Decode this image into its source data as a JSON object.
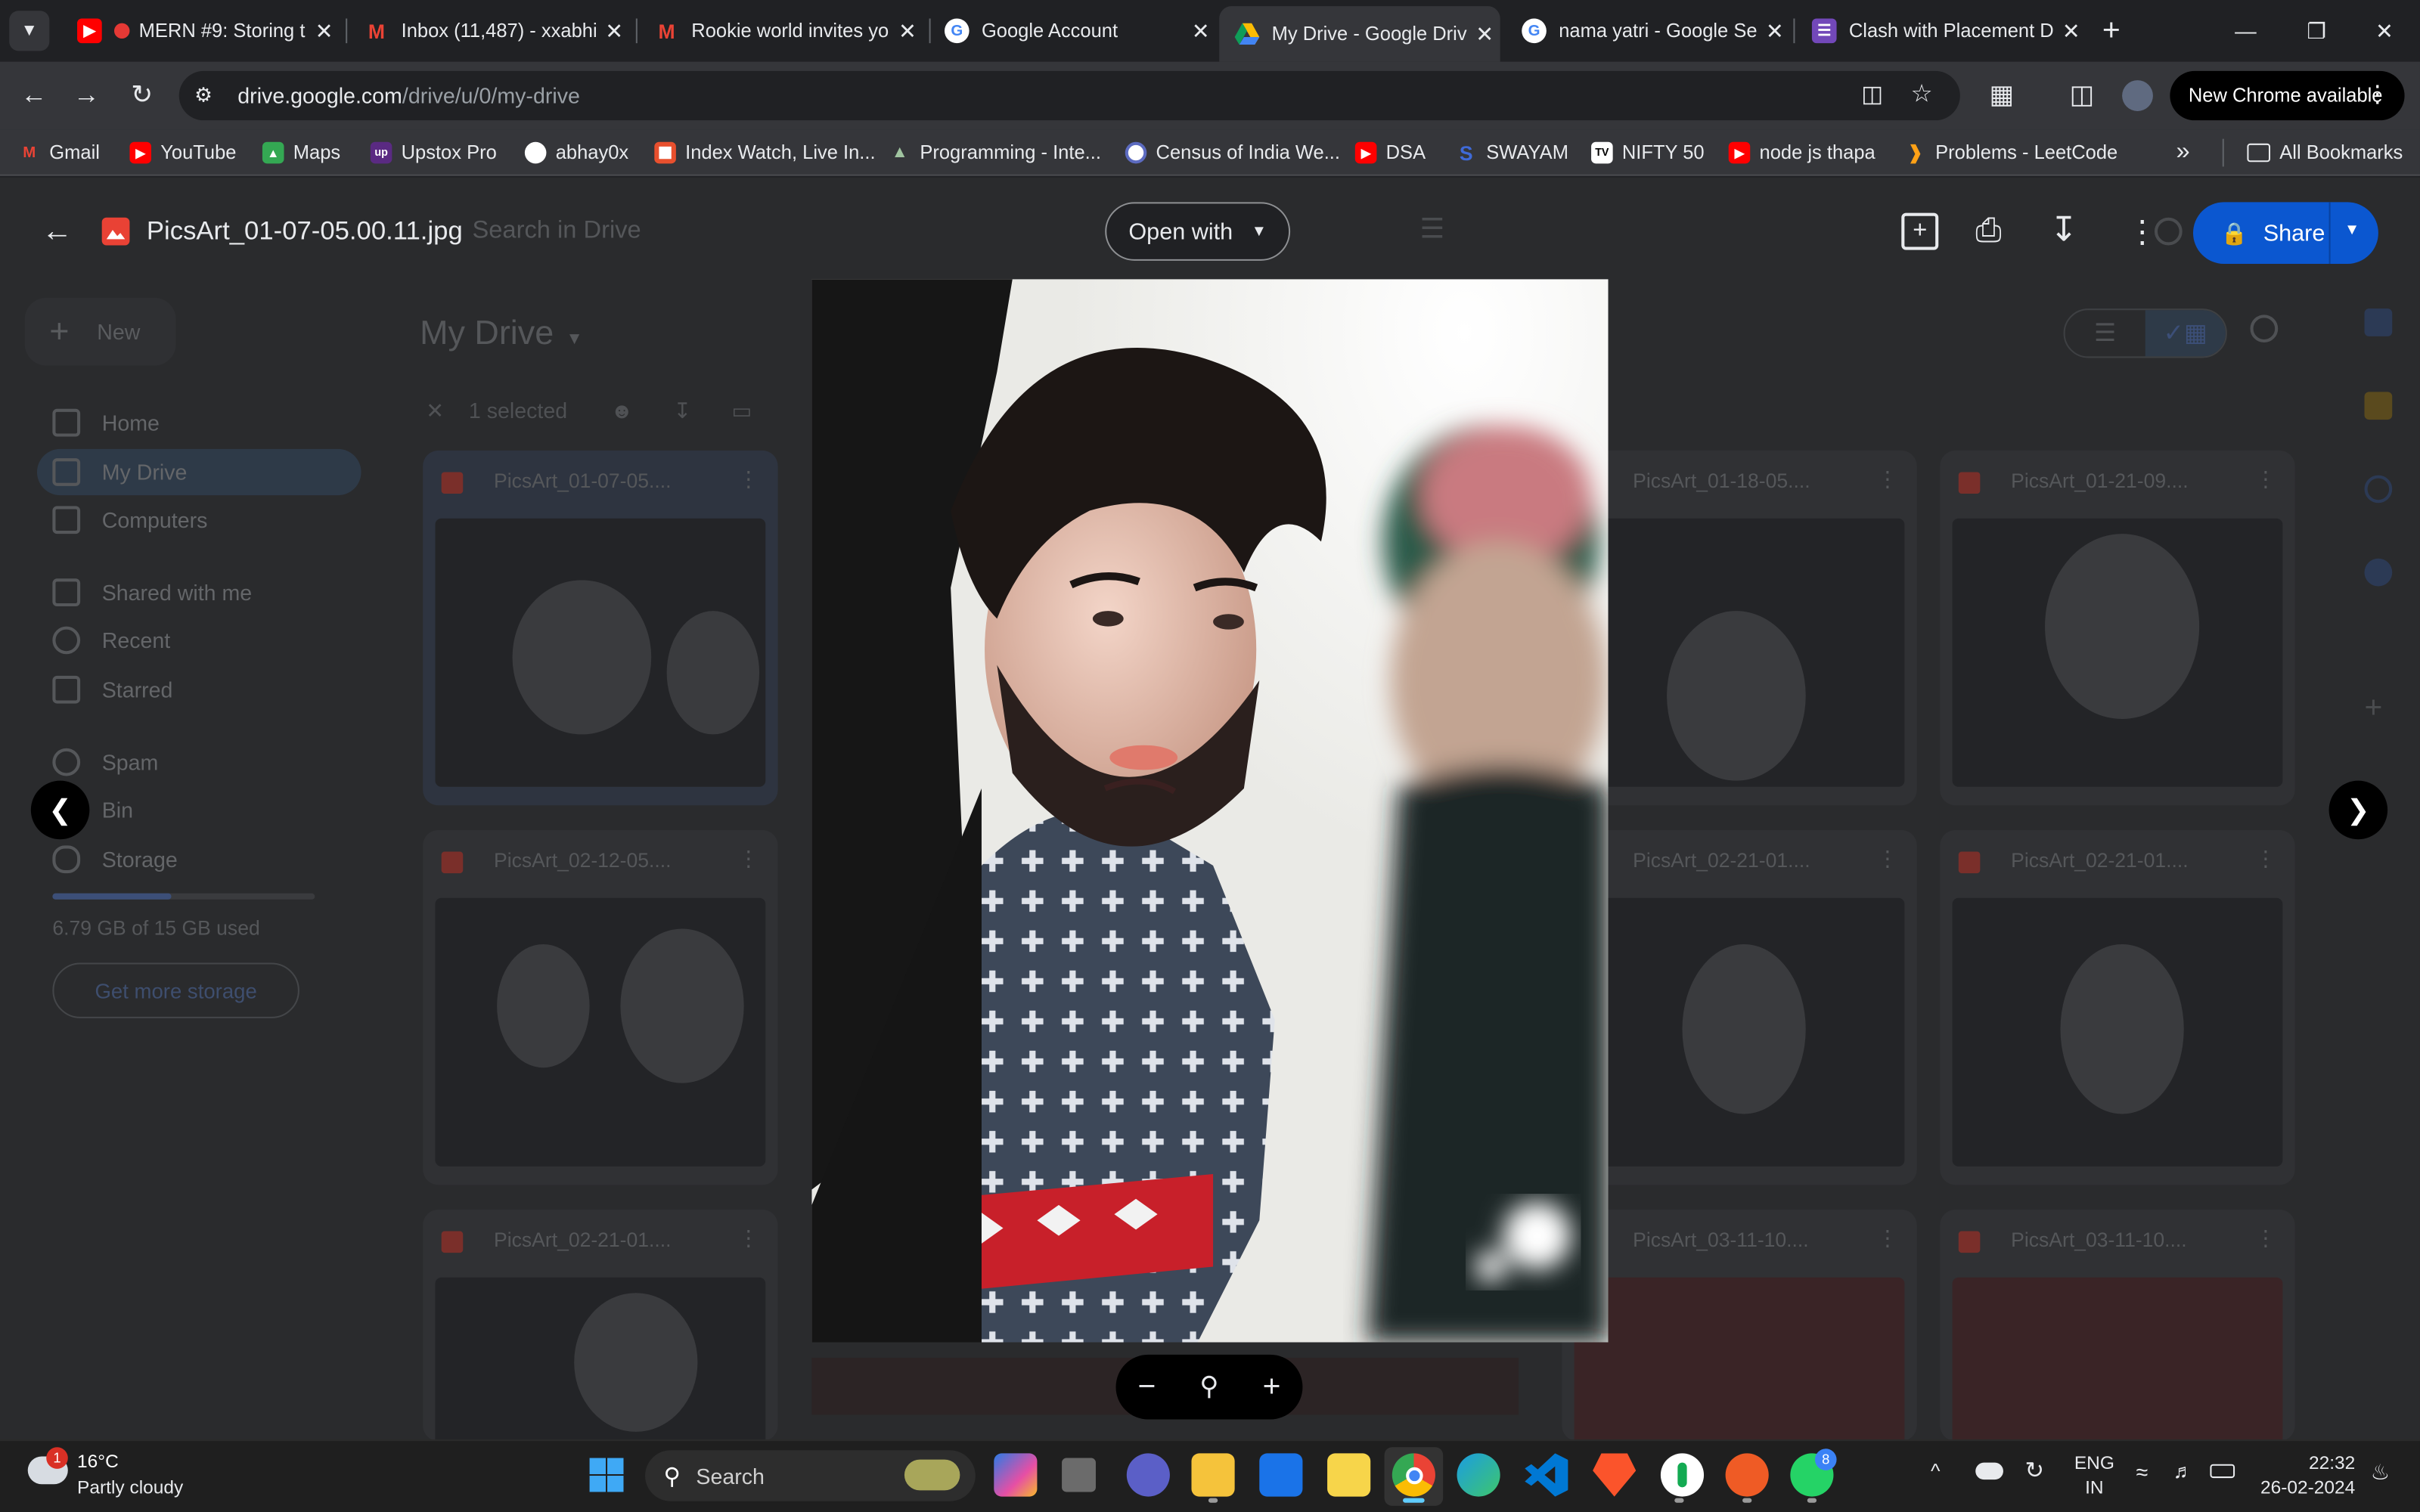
{
  "browser": {
    "tabs": [
      {
        "title": "MERN #9: Storing t",
        "icon": "youtube-icon",
        "color": "#ff0000"
      },
      {
        "title": "Inbox (11,487) - xxabhi",
        "icon": "gmail-icon",
        "color": "#ea4335"
      },
      {
        "title": "Rookie world invites yo",
        "icon": "gmail-icon",
        "color": "#ea4335"
      },
      {
        "title": "Google Account",
        "icon": "google-icon",
        "color": "#4285f4"
      },
      {
        "title": "My Drive - Google Driv",
        "icon": "drive-icon",
        "color": "#fbbc04"
      },
      {
        "title": "nama yatri - Google Se",
        "icon": "google-icon",
        "color": "#4285f4"
      },
      {
        "title": "Clash with Placement D",
        "icon": "forms-icon",
        "color": "#7248b9"
      }
    ],
    "url_host": "drive.google.com",
    "url_path": "/drive/u/0/my-drive",
    "update_label": "New Chrome available",
    "bookmarks": [
      {
        "label": "Gmail",
        "icon": "gmail-icon",
        "color": "#ea4335"
      },
      {
        "label": "YouTube",
        "icon": "youtube-icon",
        "color": "#ff0000"
      },
      {
        "label": "Maps",
        "icon": "maps-icon",
        "color": "#34a853"
      },
      {
        "label": "Upstox Pro",
        "icon": "upstox-icon",
        "color": "#5a2a82"
      },
      {
        "label": "abhay0x",
        "icon": "github-icon",
        "color": "#ffffff"
      },
      {
        "label": "Index Watch, Live In...",
        "icon": "index-icon",
        "color": "#e8502e"
      },
      {
        "label": "Programming - Inte...",
        "icon": "programming-icon",
        "color": "#a0c4a0"
      },
      {
        "label": "Census of India We...",
        "icon": "census-icon",
        "color": "#5c6bc0"
      },
      {
        "label": "DSA",
        "icon": "youtube-icon",
        "color": "#ff0000"
      },
      {
        "label": "SWAYAM",
        "icon": "swayam-icon",
        "color": "#3f6ad8"
      },
      {
        "label": "NIFTY 50",
        "icon": "tv-icon",
        "color": "#ffffff"
      },
      {
        "label": "node js thapa",
        "icon": "youtube-icon",
        "color": "#ff0000"
      },
      {
        "label": "Problems - LeetCode",
        "icon": "leetcode-icon",
        "color": "#ffa116"
      }
    ],
    "all_bookmarks_label": "All Bookmarks"
  },
  "drive": {
    "search_placeholder": "Search in Drive",
    "new_label": "New",
    "title": "My Drive",
    "selected_label": "1 selected",
    "nav": [
      "Home",
      "My Drive",
      "Computers",
      "Shared with me",
      "Recent",
      "Starred",
      "Spam",
      "Bin",
      "Storage"
    ],
    "storage_used": "6.79 GB of 15 GB used",
    "storage_fraction": 0.45,
    "get_storage_label": "Get more storage",
    "files": [
      "PicsArt_01-07-05....",
      "PicsArt_01-18-05....",
      "PicsArt_01-21-09....",
      "PicsArt_02-12-05....",
      "PicsArt_02-21-01....",
      "PicsArt_02-21-01....",
      "PicsArt_02-21-01....",
      "PicsArt_03-11-10....",
      "PicsArt_03-11-10...."
    ]
  },
  "viewer": {
    "file_name": "PicsArt_01-07-05.00.11.jpg",
    "open_with_label": "Open with",
    "share_label": "Share"
  },
  "taskbar": {
    "weather_temp": "16°C",
    "weather_desc": "Partly cloudy",
    "weather_badge": "1",
    "search_label": "Search",
    "whatsapp_badge": "8",
    "lang_top": "ENG",
    "lang_bottom": "IN",
    "time": "22:32",
    "date": "26-02-2024"
  }
}
